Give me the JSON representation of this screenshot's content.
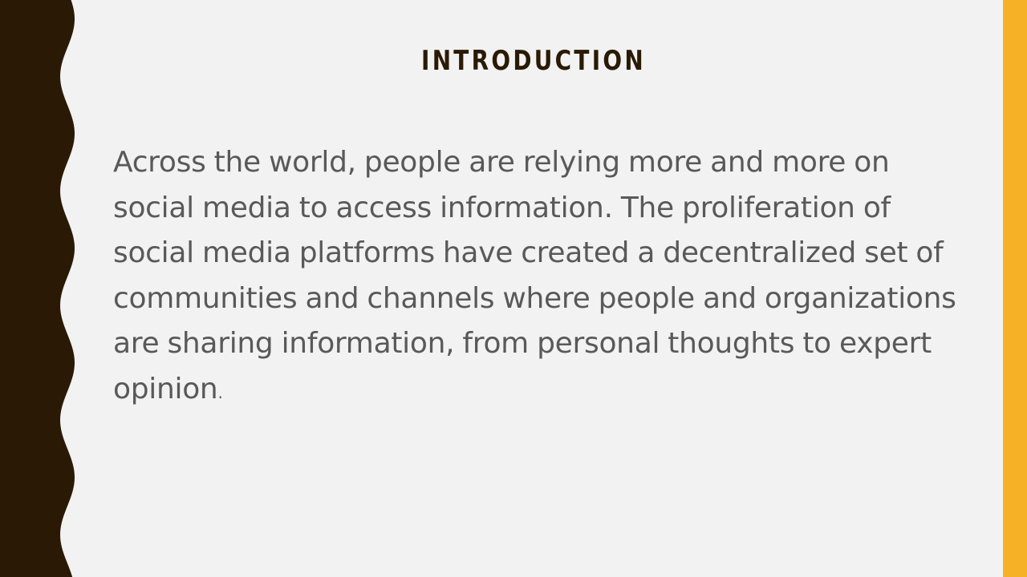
{
  "slide": {
    "title": "INTRODUCTION",
    "body_main": "Across the world, people are relying more and more on social media to access information. The proliferation of social media platforms have created a decentralized set of communities and channels where people and organizations are sharing information, from personal thoughts to expert opinion",
    "body_end": "."
  },
  "colors": {
    "background": "#f2f2f2",
    "left_border": "#2a1a05",
    "right_bar": "#f7b126",
    "title": "#2a1a05",
    "body": "#595959"
  }
}
